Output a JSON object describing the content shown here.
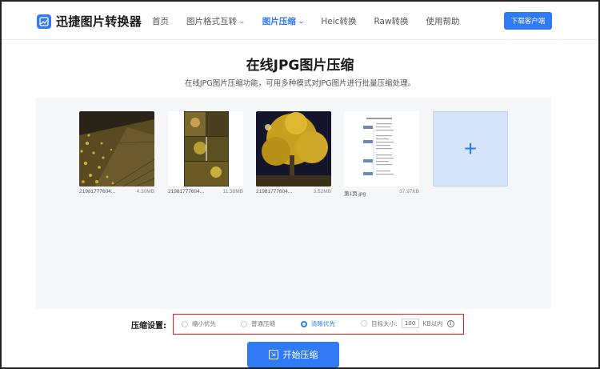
{
  "header": {
    "logo_text": "迅捷图片转换器",
    "nav": [
      {
        "label": "首页",
        "active": false,
        "dropdown": false
      },
      {
        "label": "图片格式互转",
        "active": false,
        "dropdown": true
      },
      {
        "label": "图片压缩",
        "active": true,
        "dropdown": true
      },
      {
        "label": "Heic转换",
        "active": false,
        "dropdown": false
      },
      {
        "label": "Raw转换",
        "active": false,
        "dropdown": false
      },
      {
        "label": "使用帮助",
        "active": false,
        "dropdown": false
      }
    ],
    "download_label": "下载客户端"
  },
  "page": {
    "title": "在线JPG图片压缩",
    "subtitle": "在线JPG图片压缩功能，可用多种模式对JPG图片进行批量压缩处理。"
  },
  "files": [
    {
      "name": "21981777604...",
      "size": "4.30MB"
    },
    {
      "name": "21981777604...",
      "size": "11.38MB"
    },
    {
      "name": "21981777604...",
      "size": "3.52MB"
    },
    {
      "name": "第1页.jpg",
      "size": "37.97KB"
    }
  ],
  "add_icon": "plus-icon",
  "settings": {
    "label": "压缩设置:",
    "options": [
      {
        "label": "缩小优先",
        "selected": false
      },
      {
        "label": "普通压缩",
        "selected": false
      },
      {
        "label": "清晰优先",
        "selected": true
      }
    ],
    "target_label": "目标大小:",
    "target_value": "100",
    "target_unit": "KB以内",
    "info_icon": "info-icon"
  },
  "start_button": {
    "label": "开始压缩",
    "icon": "compress-icon"
  },
  "colors": {
    "accent": "#2f7bf5",
    "highlight_border": "#e02020",
    "workspace_bg": "#f5f6f8"
  }
}
